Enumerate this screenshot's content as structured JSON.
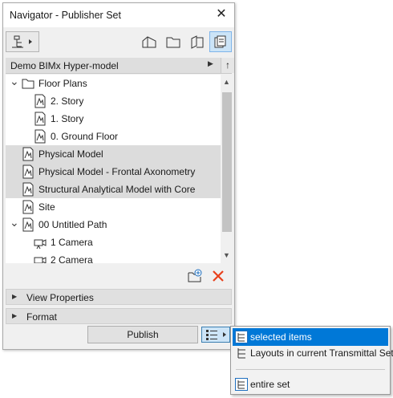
{
  "window": {
    "title": "Navigator - Publisher Set",
    "close_glyph": "✕"
  },
  "path": {
    "label": "Demo BIMx Hyper-model",
    "arrow": "▶",
    "up": "↑"
  },
  "tree": [
    {
      "label": "Floor Plans",
      "icon": "folder-icon",
      "expanded": true,
      "level": 0,
      "selected": false
    },
    {
      "label": "2. Story",
      "icon": "view-icon",
      "level": 1,
      "selected": false
    },
    {
      "label": "1. Story",
      "icon": "view-icon",
      "level": 1,
      "selected": false
    },
    {
      "label": "0. Ground Floor",
      "icon": "view-icon",
      "level": 1,
      "selected": false
    },
    {
      "label": "Physical Model",
      "icon": "view-icon",
      "level": 0,
      "selected": true
    },
    {
      "label": "Physical Model - Frontal Axonometry",
      "icon": "view-icon",
      "level": 0,
      "selected": true
    },
    {
      "label": "Structural Analytical Model with Core",
      "icon": "view-icon",
      "level": 0,
      "selected": true
    },
    {
      "label": "Site",
      "icon": "view-icon",
      "level": 0,
      "selected": false
    },
    {
      "label": "00 Untitled Path",
      "icon": "view-icon",
      "expanded": true,
      "level": 0,
      "selected": false
    },
    {
      "label": "1 Camera",
      "icon": "camera-icon",
      "level": 1,
      "selected": false
    },
    {
      "label": "2 Camera",
      "icon": "camera-icon",
      "level": 1,
      "selected": false
    }
  ],
  "panels": [
    {
      "label": "View Properties"
    },
    {
      "label": "Format"
    }
  ],
  "publish": {
    "label": "Publish"
  },
  "menu": [
    {
      "label": "selected items",
      "highlighted": true
    },
    {
      "label": "Layouts in current Transmittal Set",
      "highlighted": false
    },
    {
      "label": "entire set",
      "highlighted": false
    }
  ],
  "colors": {
    "highlight": "#0078d7",
    "delete": "#e8401c",
    "selected_row": "#dcdcdc"
  }
}
